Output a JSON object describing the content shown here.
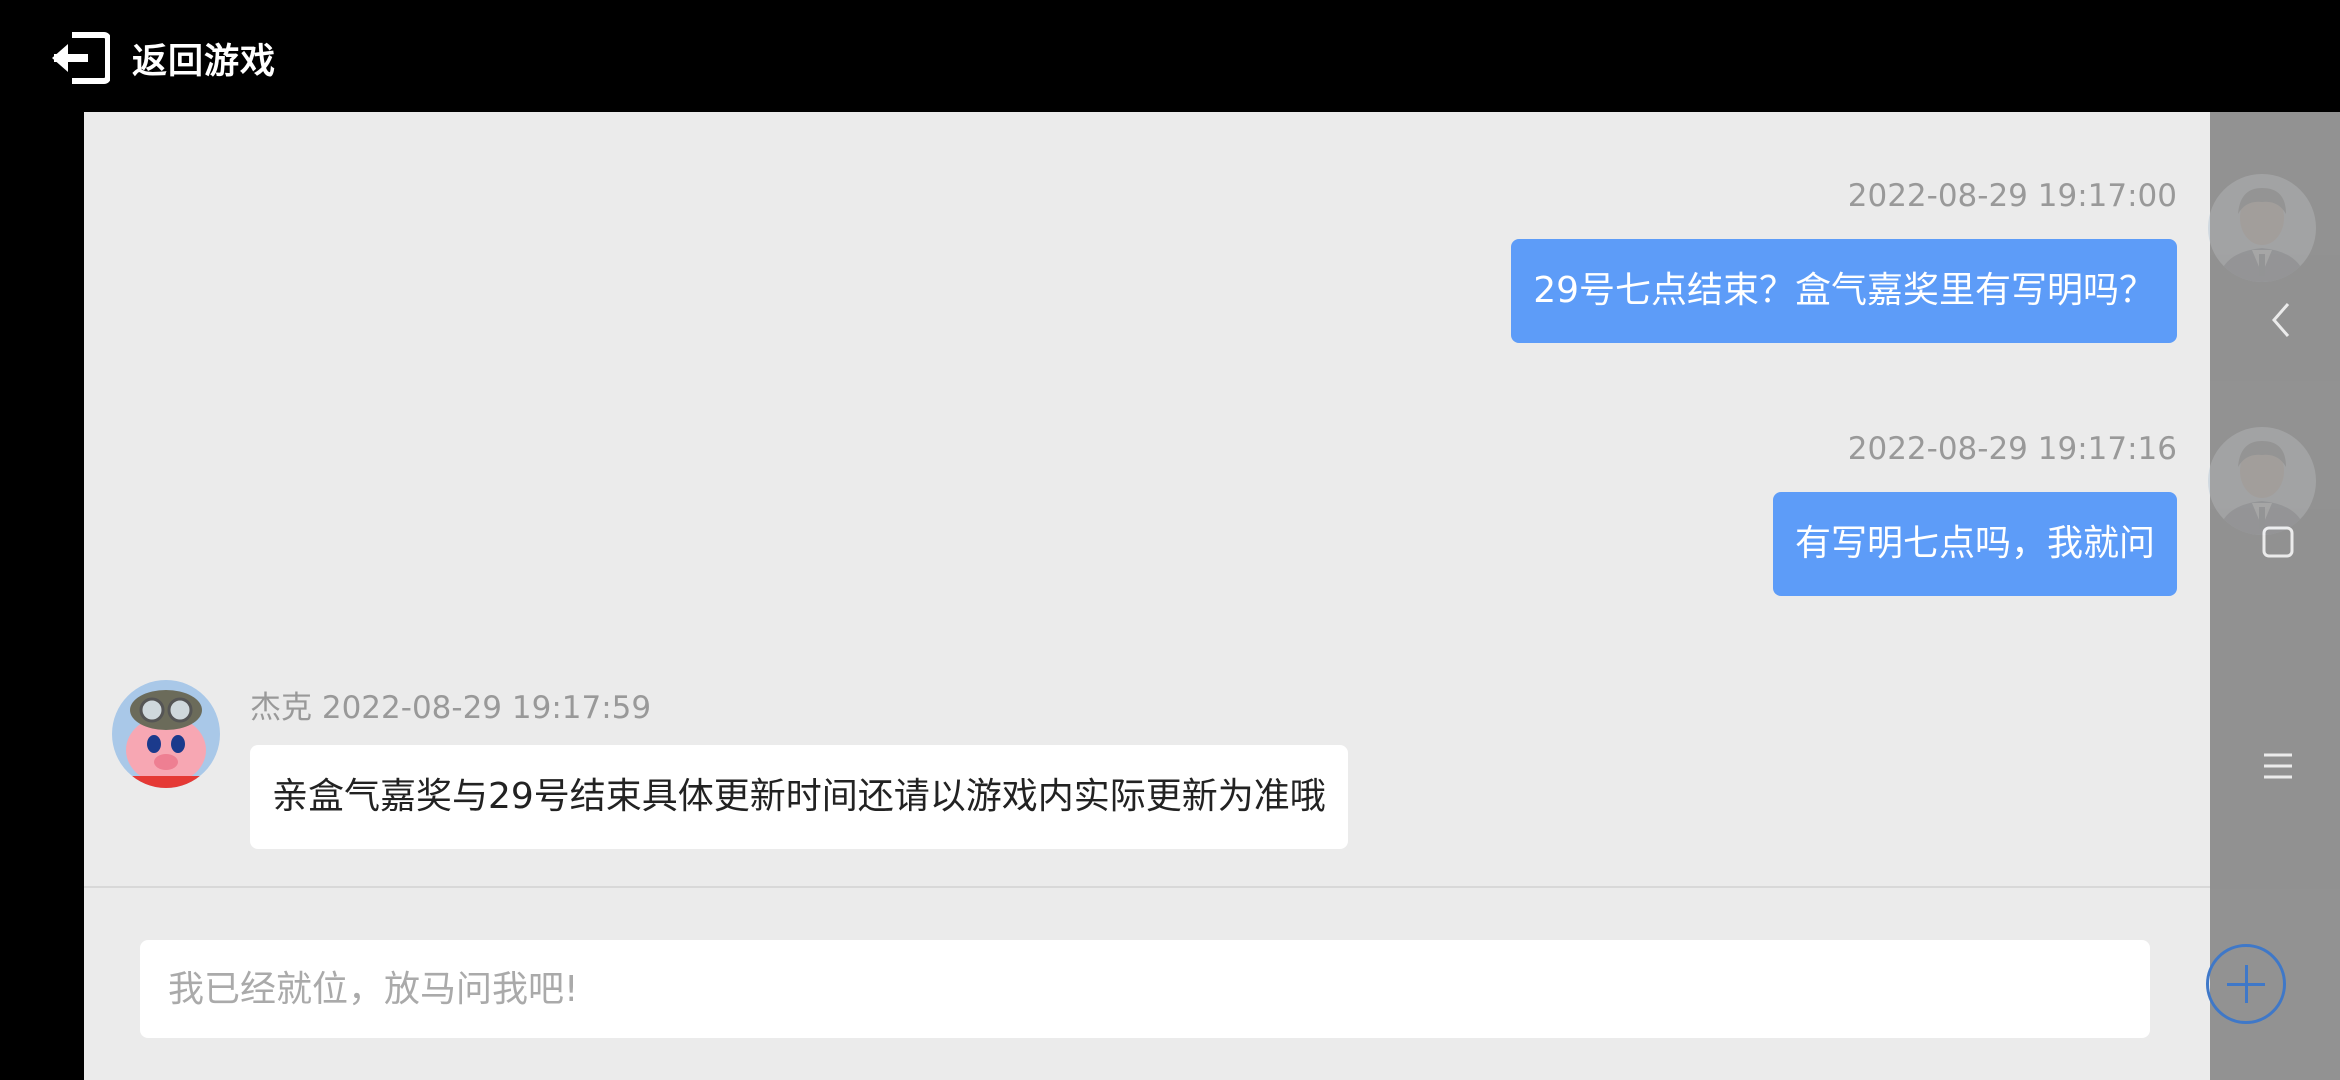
{
  "header": {
    "back_label": "返回游戏",
    "back_icon": "exit-arrow-icon"
  },
  "messages": [
    {
      "time": "2022-08-29 19:17:00",
      "text": "29号七点结束？盒气嘉奖里有写明吗？",
      "side": "out"
    },
    {
      "time": "2022-08-29 19:17:16",
      "text": "有写明七点吗，我就问",
      "side": "out"
    },
    {
      "sender": "杰克",
      "time": "2022-08-29 19:17:59",
      "text": "亲盒气嘉奖与29号结束具体更新时间还请以游戏内实际更新为准哦",
      "side": "in"
    }
  ],
  "input": {
    "placeholder": "我已经就位，放马问我吧!"
  },
  "colors": {
    "out_bubble": "#5d9cf8",
    "chat_bg": "#ebebeb",
    "accent": "#3f78c8"
  },
  "system_nav": [
    "back-chevron-icon",
    "home-square-icon",
    "menu-icon"
  ]
}
